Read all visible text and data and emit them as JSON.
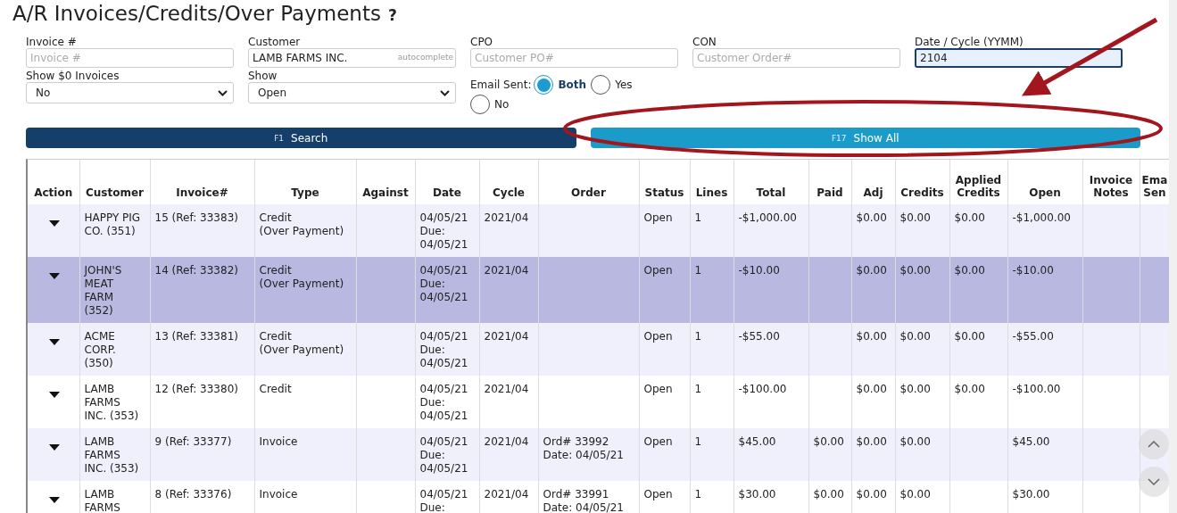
{
  "page": {
    "title": "A/R Invoices/Credits/Over Payments",
    "help": "?"
  },
  "filters": {
    "fields": [
      {
        "kind": "input",
        "label": "Invoice #",
        "placeholder": "Invoice #",
        "focused": false
      },
      {
        "kind": "input",
        "label": "Customer",
        "value": "LAMB FARMS INC.",
        "hint": "autocomplete",
        "focused": false
      },
      {
        "kind": "input",
        "label": "CPO",
        "placeholder": "Customer PO#",
        "focused": false
      },
      {
        "kind": "input",
        "label": "CON",
        "placeholder": "Customer Order#",
        "focused": false
      },
      {
        "kind": "input",
        "label": "Date / Cycle (YYMM)",
        "value": "2104",
        "focused": true
      },
      {
        "kind": "select",
        "label": "Show $0 Invoices",
        "value": "No"
      },
      {
        "kind": "select",
        "label": "Show",
        "value": "Open"
      },
      {
        "kind": "radio",
        "label": "Email Sent:",
        "options": [
          {
            "label": "Both",
            "selected": true
          },
          {
            "label": "Yes",
            "selected": false
          },
          {
            "label": "No",
            "selected": false
          }
        ]
      }
    ],
    "buttons": [
      {
        "kind": "primary",
        "key": "F1",
        "label": "Search"
      },
      {
        "kind": "secondary",
        "key": "F17",
        "label": "Show All"
      }
    ]
  },
  "table": {
    "columns": [
      {
        "label": "Action",
        "kind": "action"
      },
      {
        "label": "Customer",
        "kind": "text"
      },
      {
        "label": "Invoice#",
        "kind": "text"
      },
      {
        "label": "Type",
        "kind": "text"
      },
      {
        "label": "Against",
        "kind": "text"
      },
      {
        "label": "Date",
        "kind": "text"
      },
      {
        "label": "Cycle",
        "kind": "text"
      },
      {
        "label": "Order",
        "kind": "text"
      },
      {
        "label": "Status",
        "kind": "text"
      },
      {
        "label": "Lines",
        "kind": "text"
      },
      {
        "label": "Total",
        "kind": "text"
      },
      {
        "label": "Paid",
        "kind": "text"
      },
      {
        "label": "Adj",
        "kind": "text"
      },
      {
        "label": "Credits",
        "kind": "text"
      },
      {
        "label": "Applied Credits",
        "kind": "text"
      },
      {
        "label": "Open",
        "kind": "text"
      },
      {
        "label": "Invoice Notes",
        "kind": "text"
      },
      {
        "label": "Ema Sen",
        "kind": "text"
      }
    ],
    "rows": [
      {
        "selected": false,
        "cells": [
          null,
          "HAPPY PIG\nCO. (351)",
          "15 (Ref: 33383)",
          "Credit\n(Over Payment)",
          null,
          "04/05/21\nDue:\n04/05/21",
          "2021/04",
          null,
          "Open",
          "1",
          "-$1,000.00",
          null,
          "$0.00",
          "$0.00",
          "$0.00",
          "-$1,000.00",
          null,
          null
        ]
      },
      {
        "selected": true,
        "cells": [
          null,
          "JOHN'S\nMEAT\nFARM\n(352)",
          "14 (Ref: 33382)",
          "Credit\n(Over Payment)",
          null,
          "04/05/21\nDue:\n04/05/21",
          "2021/04",
          null,
          "Open",
          "1",
          "-$10.00",
          null,
          "$0.00",
          "$0.00",
          "$0.00",
          "-$10.00",
          null,
          null
        ]
      },
      {
        "selected": false,
        "cells": [
          null,
          "ACME\nCORP.\n(350)",
          "13 (Ref: 33381)",
          "Credit\n(Over Payment)",
          null,
          "04/05/21\nDue:\n04/05/21",
          "2021/04",
          null,
          "Open",
          "1",
          "-$55.00",
          null,
          "$0.00",
          "$0.00",
          "$0.00",
          "-$55.00",
          null,
          null
        ]
      },
      {
        "selected": false,
        "cells": [
          null,
          "LAMB\nFARMS\nINC. (353)",
          "12 (Ref: 33380)",
          "Credit",
          null,
          "04/05/21\nDue:\n04/05/21",
          "2021/04",
          null,
          "Open",
          "1",
          "-$100.00",
          null,
          "$0.00",
          "$0.00",
          "$0.00",
          "-$100.00",
          null,
          null
        ]
      },
      {
        "selected": false,
        "cells": [
          null,
          "LAMB\nFARMS\nINC. (353)",
          "9 (Ref: 33377)",
          "Invoice",
          null,
          "04/05/21\nDue:\n04/05/21",
          "2021/04",
          "Ord# 33992\nDate: 04/05/21",
          "Open",
          "1",
          "$45.00",
          "$0.00",
          "$0.00",
          "$0.00",
          null,
          "$45.00",
          null,
          null
        ]
      },
      {
        "selected": false,
        "cells": [
          null,
          "LAMB\nFARMS",
          "8 (Ref: 33376)",
          "Invoice",
          null,
          "04/05/21\nDue:",
          "2021/04",
          "Ord# 33991\nDate: 04/05/21",
          "Open",
          "1",
          "$30.00",
          "$0.00",
          "$0.00",
          "$0.00",
          null,
          "$30.00",
          null,
          null
        ]
      }
    ]
  }
}
